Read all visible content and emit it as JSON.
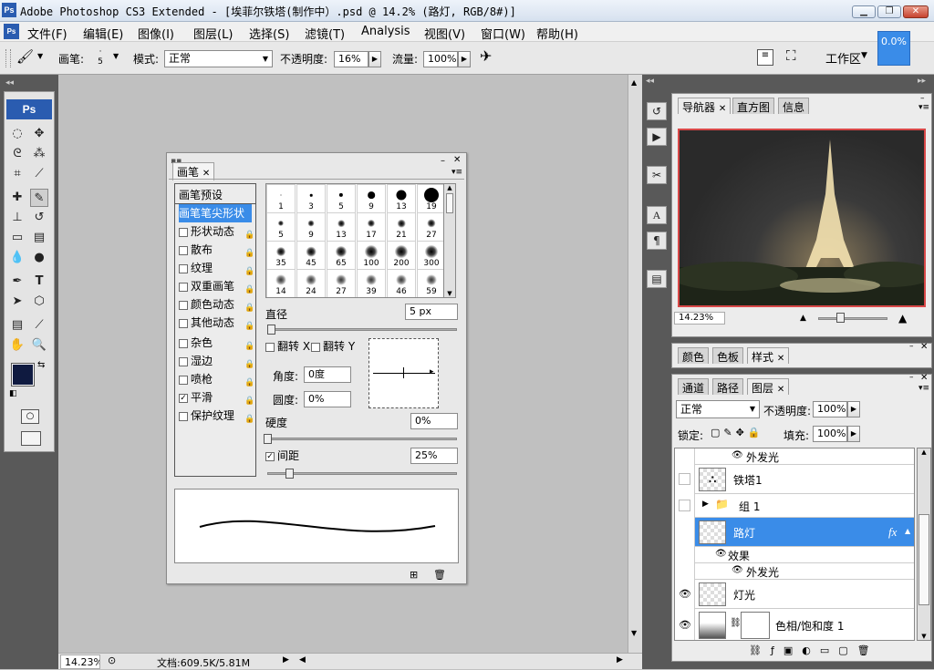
{
  "window": {
    "title": "Adobe Photoshop CS3 Extended - [埃菲尔铁塔(制作中）.psd @ 14.2% (路灯, RGB/8#)]",
    "logo": "Ps"
  },
  "menubar": [
    "文件(F)",
    "编辑(E)",
    "图像(I)",
    "图层(L)",
    "选择(S)",
    "滤镜(T)",
    "Analysis",
    "视图(V)",
    "窗口(W)",
    "帮助(H)"
  ],
  "progress_badge": "0.0%",
  "options": {
    "brush_label": "画笔:",
    "brush_size": "5",
    "mode_label": "模式:",
    "mode_value": "正常",
    "opacity_label": "不透明度:",
    "opacity_value": "16%",
    "flow_label": "流量:",
    "flow_value": "100%",
    "workspace": "工作区"
  },
  "toolbox": {
    "logo": "Ps"
  },
  "brush_panel": {
    "tab": "画笔",
    "options": [
      {
        "label": "画笔预设",
        "checkbox": false,
        "lock": false,
        "selected": false
      },
      {
        "label": "画笔笔尖形状",
        "checkbox": false,
        "lock": false,
        "selected": true
      },
      {
        "label": "形状动态",
        "checkbox": true,
        "checked": false,
        "lock": true
      },
      {
        "label": "散布",
        "checkbox": true,
        "checked": false,
        "lock": true
      },
      {
        "label": "纹理",
        "checkbox": true,
        "checked": false,
        "lock": true
      },
      {
        "label": "双重画笔",
        "checkbox": true,
        "checked": false,
        "lock": true
      },
      {
        "label": "颜色动态",
        "checkbox": true,
        "checked": false,
        "lock": true
      },
      {
        "label": "其他动态",
        "checkbox": true,
        "checked": false,
        "lock": true
      },
      {
        "label": "杂色",
        "checkbox": true,
        "checked": false,
        "lock": true
      },
      {
        "label": "湿边",
        "checkbox": true,
        "checked": false,
        "lock": true
      },
      {
        "label": "喷枪",
        "checkbox": true,
        "checked": false,
        "lock": true
      },
      {
        "label": "平滑",
        "checkbox": true,
        "checked": true,
        "lock": true
      },
      {
        "label": "保护纹理",
        "checkbox": true,
        "checked": false,
        "lock": true
      }
    ],
    "tips": [
      {
        "size": "1",
        "kind": "hard"
      },
      {
        "size": "3",
        "kind": "hard"
      },
      {
        "size": "5",
        "kind": "hard"
      },
      {
        "size": "9",
        "kind": "hard"
      },
      {
        "size": "13",
        "kind": "hard"
      },
      {
        "size": "19",
        "kind": "hard"
      },
      {
        "size": "5",
        "kind": "soft"
      },
      {
        "size": "9",
        "kind": "soft"
      },
      {
        "size": "13",
        "kind": "soft"
      },
      {
        "size": "17",
        "kind": "soft"
      },
      {
        "size": "21",
        "kind": "soft"
      },
      {
        "size": "27",
        "kind": "soft"
      },
      {
        "size": "35",
        "kind": "soft"
      },
      {
        "size": "45",
        "kind": "soft"
      },
      {
        "size": "65",
        "kind": "soft"
      },
      {
        "size": "100",
        "kind": "soft"
      },
      {
        "size": "200",
        "kind": "soft"
      },
      {
        "size": "300",
        "kind": "soft"
      },
      {
        "size": "14",
        "kind": "sprite"
      },
      {
        "size": "24",
        "kind": "sprite"
      },
      {
        "size": "27",
        "kind": "sprite"
      },
      {
        "size": "39",
        "kind": "sprite"
      },
      {
        "size": "46",
        "kind": "sprite"
      },
      {
        "size": "59",
        "kind": "sprite"
      }
    ],
    "diameter_label": "直径",
    "diameter_value": "5 px",
    "flip_x": "翻转 X",
    "flip_y": "翻转 Y",
    "angle_label": "角度:",
    "angle_value": "0度",
    "roundness_label": "圆度:",
    "roundness_value": "0%",
    "hardness_label": "硬度",
    "hardness_value": "0%",
    "spacing_label": "间距",
    "spacing_value": "25%"
  },
  "status": {
    "zoom": "14.23%",
    "doc": "文档:609.5K/5.81M"
  },
  "navigator": {
    "tabs": [
      "导航器",
      "直方图",
      "信息"
    ],
    "zoom": "14.23%"
  },
  "color_panel": {
    "tabs": [
      "颜色",
      "色板",
      "样式"
    ]
  },
  "layers_panel": {
    "tabs": [
      "通道",
      "路径",
      "图层"
    ],
    "blend_mode": "正常",
    "opacity_label": "不透明度:",
    "opacity_value": "100%",
    "lock_label": "锁定:",
    "fill_label": "填充:",
    "fill_value": "100%",
    "rows": [
      {
        "name": "外发光",
        "kind": "effect-item",
        "visible": true
      },
      {
        "name": "铁塔1",
        "kind": "layer",
        "visible": false,
        "thumb": "tower"
      },
      {
        "name": "组 1",
        "kind": "group",
        "visible": false
      },
      {
        "name": "路灯",
        "kind": "layer",
        "visible": true,
        "selected": true,
        "fx": "fx"
      },
      {
        "name": "效果",
        "kind": "effect-header",
        "visible": true
      },
      {
        "name": "外发光",
        "kind": "effect-item",
        "visible": true
      },
      {
        "name": "灯光",
        "kind": "layer",
        "visible": true
      },
      {
        "name": "色相/饱和度 1",
        "kind": "adjustment",
        "visible": true
      }
    ]
  },
  "colors": {
    "accent": "#3a8ce8",
    "selection": "#3a8ce8",
    "foreground": "#0f1a40",
    "background": "#000000"
  }
}
